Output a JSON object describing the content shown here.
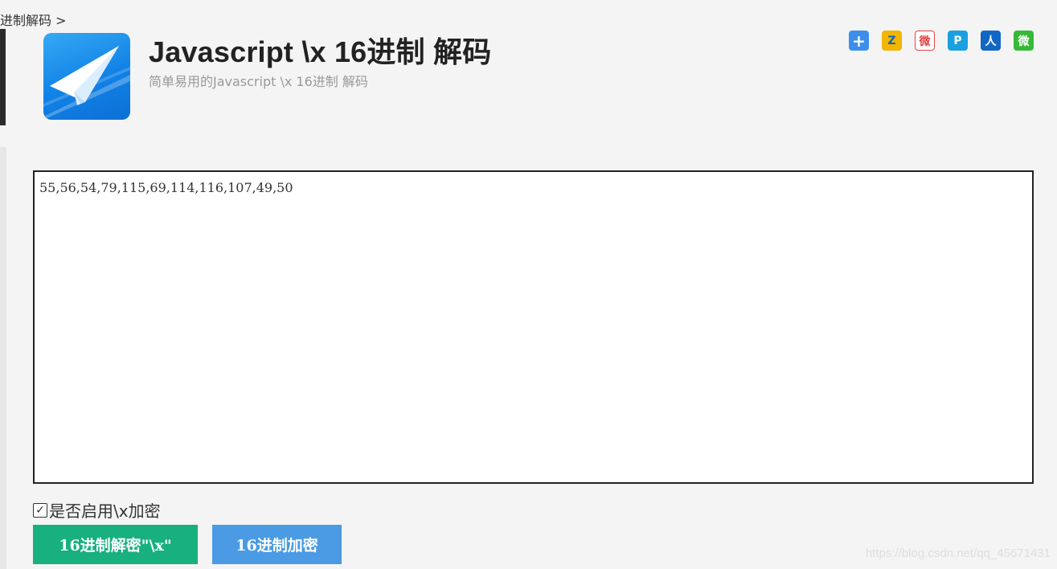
{
  "breadcrumb": {
    "text": "进制解码 >"
  },
  "header": {
    "title": "Javascript \\x 16进制 解码",
    "subtitle": "简单易用的Javascript \\x 16进制 解码"
  },
  "share": {
    "plus": "+",
    "qzone": "Z",
    "weibo": "微",
    "pengyou": "P",
    "renren": "人",
    "wechat": "微"
  },
  "editor": {
    "value": "55,56,54,79,115,69,114,116,107,49,50"
  },
  "options": {
    "check_mark": "✓",
    "enable_x_label": "是否启用\\x加密"
  },
  "buttons": {
    "decode_label": "16进制解密\"\\x\"",
    "encode_label": "16进制加密"
  },
  "watermark": {
    "text": "https://blog.csdn.net/qq_45671431"
  },
  "colors": {
    "decode_button": "#17b07e",
    "encode_button": "#4a9be4",
    "app_icon": "#1182e6"
  }
}
